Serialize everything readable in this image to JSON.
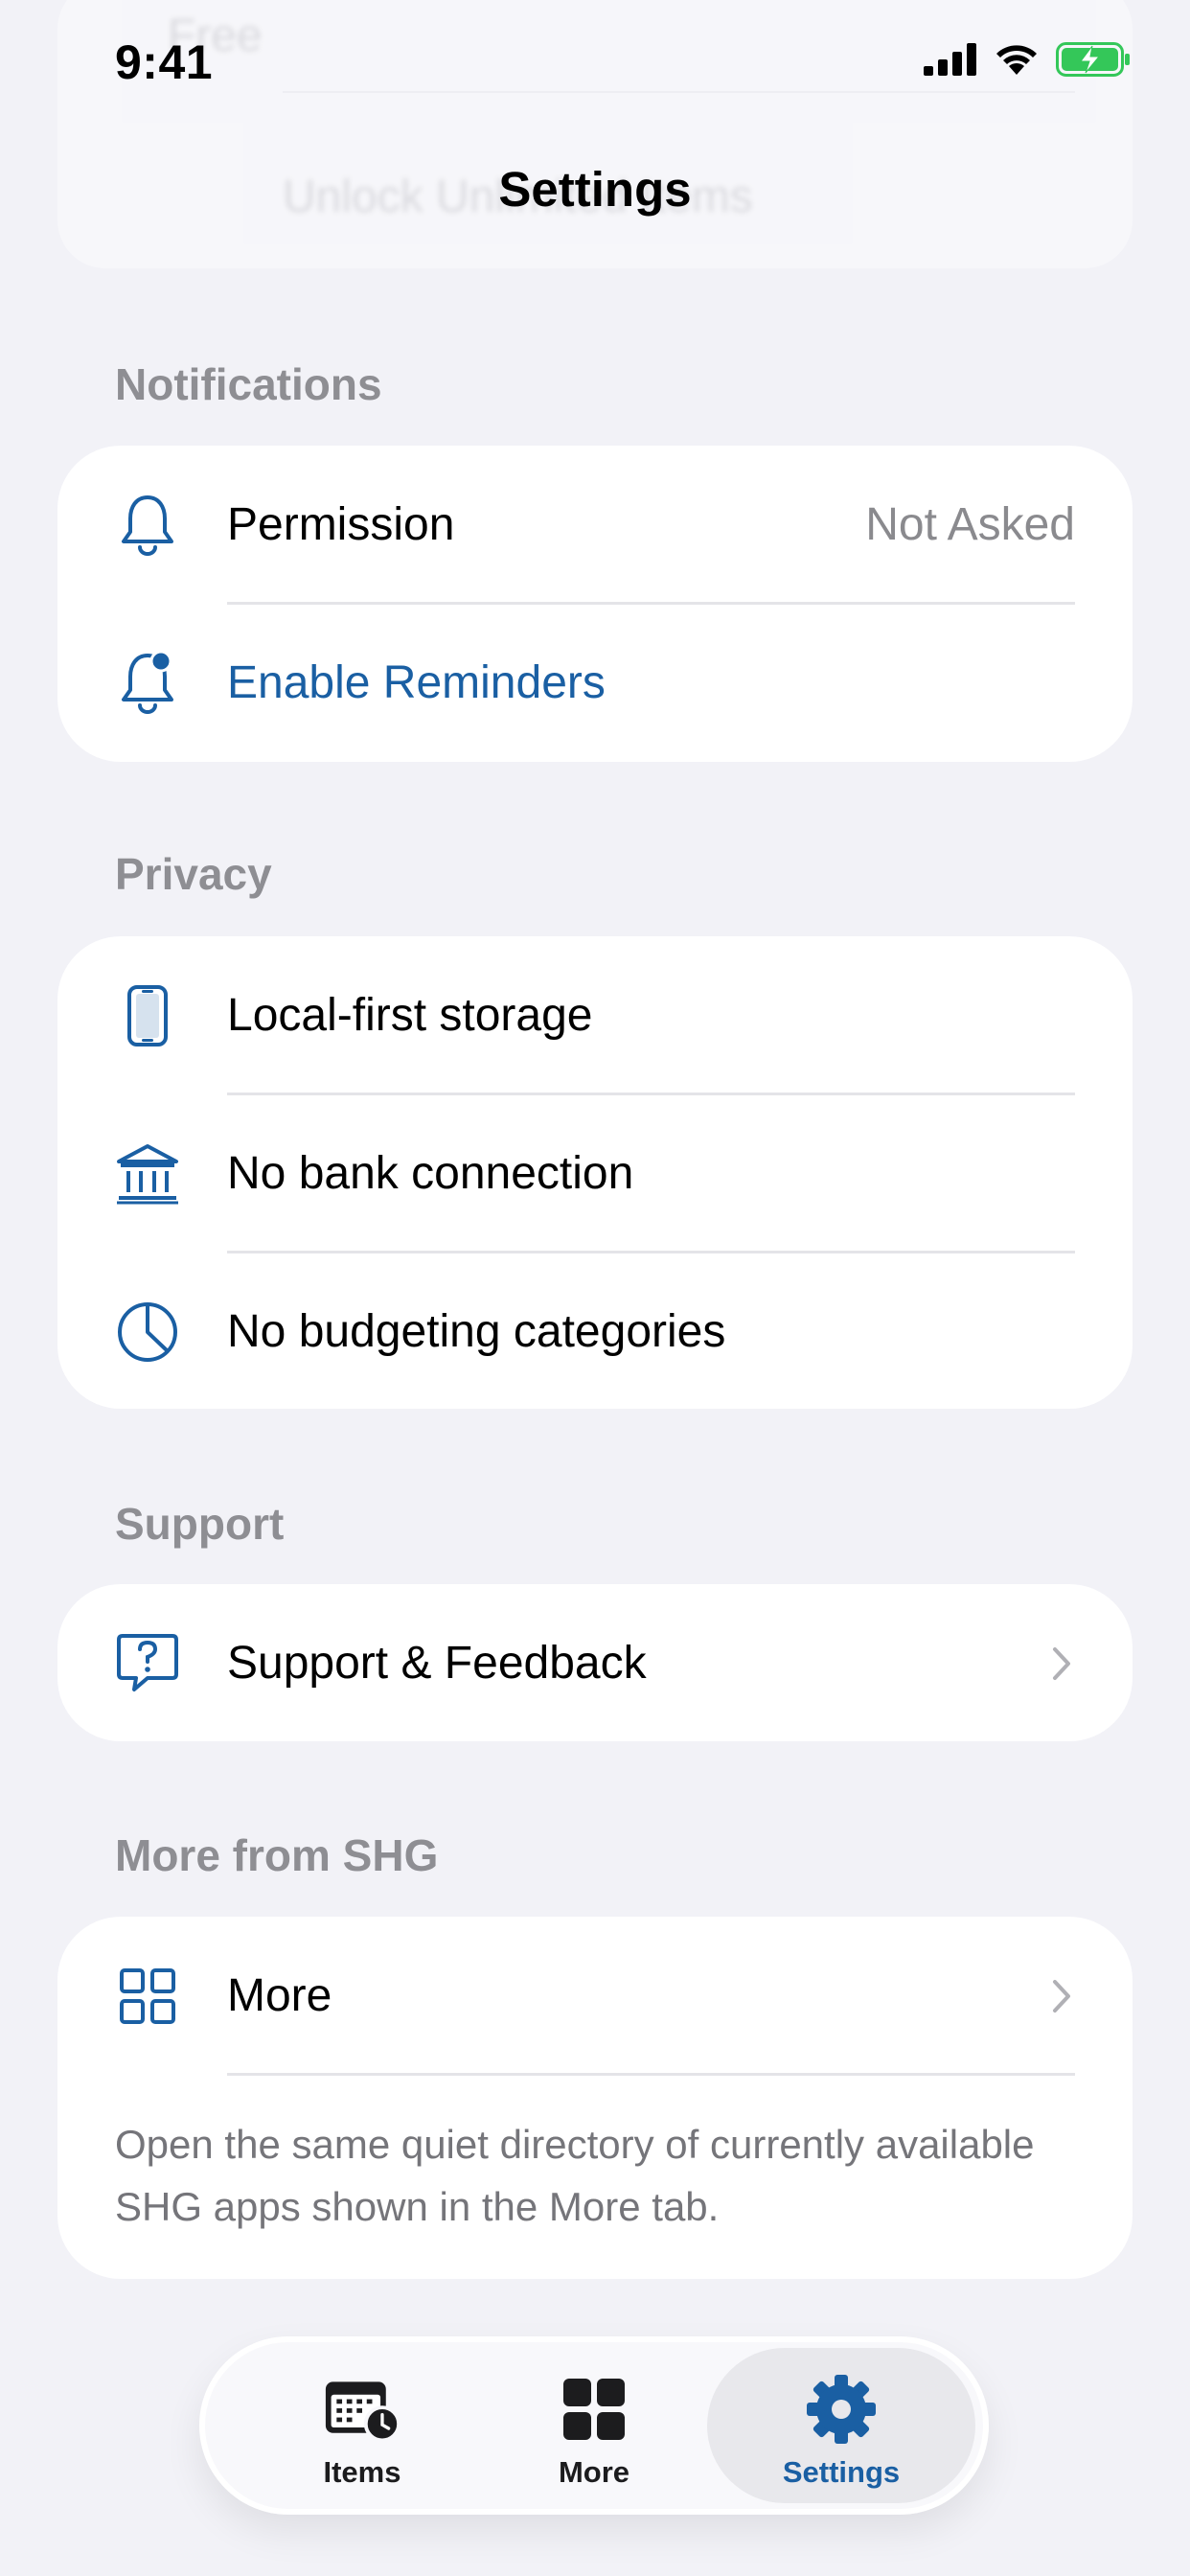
{
  "status": {
    "time": "9:41",
    "icons": [
      "cellular-signal-icon",
      "wifi-icon",
      "battery-charging-icon"
    ]
  },
  "background_rows": {
    "row1_label": "Free",
    "row2_label": "Unlock Unlimited Items"
  },
  "nav": {
    "title": "Settings"
  },
  "sections": {
    "notifications": {
      "header": "Notifications",
      "permission_label": "Permission",
      "permission_value": "Not Asked",
      "enable_label": "Enable Reminders"
    },
    "privacy": {
      "header": "Privacy",
      "items": [
        {
          "label": "Local-first storage",
          "icon": "phone-icon"
        },
        {
          "label": "No bank connection",
          "icon": "bank-icon"
        },
        {
          "label": "No budgeting categories",
          "icon": "pie-chart-icon"
        }
      ]
    },
    "support": {
      "header": "Support",
      "feedback_label": "Support & Feedback"
    },
    "more_from": {
      "header": "More from SHG",
      "more_label": "More",
      "footnote": "Open the same quiet directory of currently available SHG apps shown in the More tab."
    }
  },
  "tabs": [
    {
      "label": "Items",
      "icon": "calendar-clock-icon"
    },
    {
      "label": "More",
      "icon": "grid-icon"
    },
    {
      "label": "Settings",
      "icon": "gear-icon",
      "selected": true
    }
  ],
  "colors": {
    "accent": "#1a5fa3",
    "background": "#f2f2f7",
    "secondary_text": "#8e8e93"
  }
}
